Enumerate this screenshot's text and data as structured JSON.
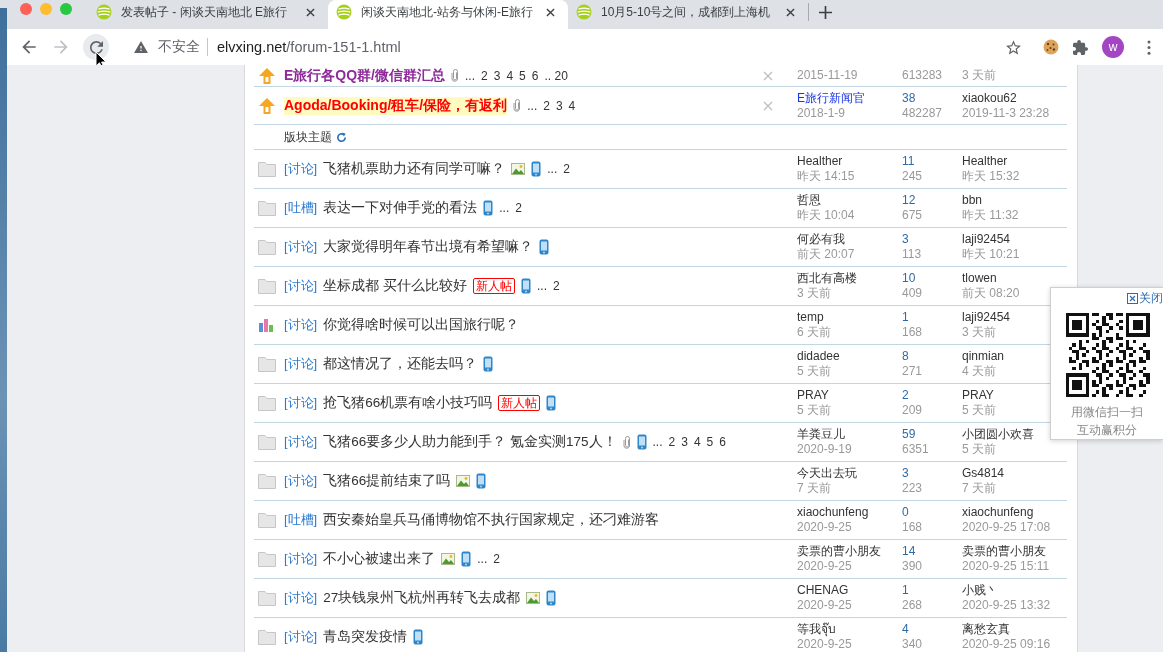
{
  "browser": {
    "tabs": [
      {
        "title": "发表帖子 - 闲谈天南地北 E旅行",
        "selected": false
      },
      {
        "title": "闲谈天南地北-站务与休闲-E旅行",
        "selected": true
      },
      {
        "title": "10月5-10号之间，成都到上海机",
        "selected": false
      }
    ],
    "security_label": "不安全",
    "url": {
      "host": "elvxing.net",
      "path": "/forum-151-1.html"
    },
    "profile_initial": "w"
  },
  "pinned_threads": [
    {
      "kind": "pinned",
      "title": "E旅行各QQ群/微信群汇总",
      "color": "#8e2a9a",
      "highlighted": false,
      "marks": [
        {
          "kind": "attachment"
        }
      ],
      "pages": {
        "lead": "...",
        "numbers": [
          "2",
          "3",
          "4",
          "5",
          "6",
          ".. 20"
        ]
      },
      "posted": "2015-11-19",
      "views": "613283",
      "last_time": "3 天前"
    },
    {
      "kind": "pinned",
      "title": "Agoda/Booking/租车/保险，有返利",
      "color": "#ff0000",
      "highlighted": true,
      "marks": [
        {
          "kind": "attachment"
        }
      ],
      "pages": {
        "lead": "...",
        "numbers": [
          "2",
          "3",
          "4"
        ]
      },
      "author": {
        "name": "E旅行新闻官",
        "color": "#1a35e6"
      },
      "posted": "2018-1-9",
      "replies": "38",
      "views": "482287",
      "last_poster": "xiaokou62",
      "last_time": "2019-11-3 23:28"
    }
  ],
  "section_label": "版块主题",
  "threads": [
    {
      "kind": "normal",
      "category": "[讨论]",
      "title": "飞猪机票助力还有同学可嘛？",
      "marks": [
        {
          "kind": "image"
        },
        {
          "kind": "mobile"
        }
      ],
      "pages": {
        "lead": "...",
        "numbers": [
          "2"
        ]
      },
      "author": "Healther",
      "posted": "昨天 14:15",
      "replies": "11",
      "views": "245",
      "last_poster": "Healther",
      "last_time": "昨天 15:32"
    },
    {
      "kind": "normal",
      "category": "[吐槽]",
      "title": "表达一下对伸手党的看法",
      "marks": [
        {
          "kind": "mobile"
        }
      ],
      "pages": {
        "lead": "...",
        "numbers": [
          "2"
        ]
      },
      "author": "哲恩",
      "posted": "昨天 10:04",
      "replies": "12",
      "views": "675",
      "last_poster": "bbn",
      "last_time": "昨天 11:32"
    },
    {
      "kind": "normal",
      "category": "[讨论]",
      "title": "大家觉得明年春节出境有希望嘛？",
      "marks": [
        {
          "kind": "mobile"
        }
      ],
      "author": "何必有我",
      "posted": "前天 20:07",
      "replies": "3",
      "views": "113",
      "last_poster": "laji92454",
      "last_time": "昨天 10:21"
    },
    {
      "kind": "normal",
      "category": "[讨论]",
      "title": "坐标成都 买什么比较好",
      "badge": "新人帖",
      "marks": [
        {
          "kind": "mobile"
        }
      ],
      "pages": {
        "lead": "...",
        "numbers": [
          "2"
        ]
      },
      "author": "西北有高楼",
      "posted": "3 天前",
      "replies": "10",
      "views": "409",
      "last_poster": "tlowen",
      "last_time": "前天 08:20"
    },
    {
      "kind": "poll",
      "category": "[讨论]",
      "title": "你觉得啥时候可以出国旅行呢？",
      "author": "temp",
      "posted": "6 天前",
      "replies": "1",
      "views": "168",
      "last_poster": "laji92454",
      "last_time": "3 天前"
    },
    {
      "kind": "normal",
      "category": "[讨论]",
      "title": "都这情况了，还能去吗？",
      "marks": [
        {
          "kind": "mobile"
        }
      ],
      "author": "didadee",
      "posted": "5 天前",
      "replies": "8",
      "views": "271",
      "last_poster": "qinmian",
      "last_time": "4 天前"
    },
    {
      "kind": "normal",
      "category": "[讨论]",
      "title": "抢飞猪66机票有啥小技巧吗",
      "badge": "新人帖",
      "marks": [
        {
          "kind": "mobile"
        }
      ],
      "author": "PRAY",
      "posted": "5 天前",
      "replies": "2",
      "views": "209",
      "last_poster": "PRAY",
      "last_time": "5 天前"
    },
    {
      "kind": "normal",
      "category": "[讨论]",
      "title": "飞猪66要多少人助力能到手？ 氪金实测175人！",
      "marks": [
        {
          "kind": "attachment"
        },
        {
          "kind": "mobile"
        }
      ],
      "pages": {
        "lead": "...",
        "numbers": [
          "2",
          "3",
          "4",
          "5",
          "6"
        ]
      },
      "author": "羊粪豆儿",
      "posted": "2020-9-19",
      "replies": "59",
      "views": "6351",
      "last_poster": "小团圆小欢喜",
      "last_time": "5 天前"
    },
    {
      "kind": "normal",
      "category": "[讨论]",
      "title": "飞猪66提前结束了吗",
      "marks": [
        {
          "kind": "image"
        },
        {
          "kind": "mobile"
        }
      ],
      "author": "今天出去玩",
      "posted": "7 天前",
      "replies": "3",
      "views": "223",
      "last_poster": "Gs4814",
      "last_time": "7 天前"
    },
    {
      "kind": "normal",
      "category": "[吐槽]",
      "title": "西安秦始皇兵马俑博物馆不执行国家规定，还刁难游客",
      "author": "xiaochunfeng",
      "posted": "2020-9-25",
      "replies": "0",
      "views": "168",
      "last_poster": "xiaochunfeng",
      "last_time": "2020-9-25 17:08"
    },
    {
      "kind": "normal",
      "category": "[讨论]",
      "title": "不小心被逮出来了",
      "marks": [
        {
          "kind": "image"
        },
        {
          "kind": "mobile"
        }
      ],
      "pages": {
        "lead": "...",
        "numbers": [
          "2"
        ]
      },
      "author": "卖票的曹小朋友",
      "posted": "2020-9-25",
      "replies": "14",
      "views": "390",
      "last_poster": "卖票的曹小朋友",
      "last_time": "2020-9-25 15:11"
    },
    {
      "kind": "normal",
      "category": "[讨论]",
      "title": "27块钱泉州飞杭州再转飞去成都",
      "marks": [
        {
          "kind": "image"
        },
        {
          "kind": "mobile"
        }
      ],
      "author": "CHENAG",
      "posted": "2020-9-25",
      "replies": "1",
      "views": "268",
      "last_poster": "小贱丶",
      "last_time": "2020-9-25 13:32"
    },
    {
      "kind": "normal",
      "category": "[讨论]",
      "title": "青岛突发疫情",
      "marks": [
        {
          "kind": "mobile"
        }
      ],
      "author": "等我จุ๊บ",
      "posted": "2020-9-25",
      "replies": "4",
      "views": "340",
      "last_poster": "离愁玄真",
      "last_time": "2020-9-25 09:16"
    }
  ],
  "qr_popup": {
    "close_label": "关闭",
    "lines": [
      "用微信扫一扫",
      "互动赢积分"
    ]
  }
}
